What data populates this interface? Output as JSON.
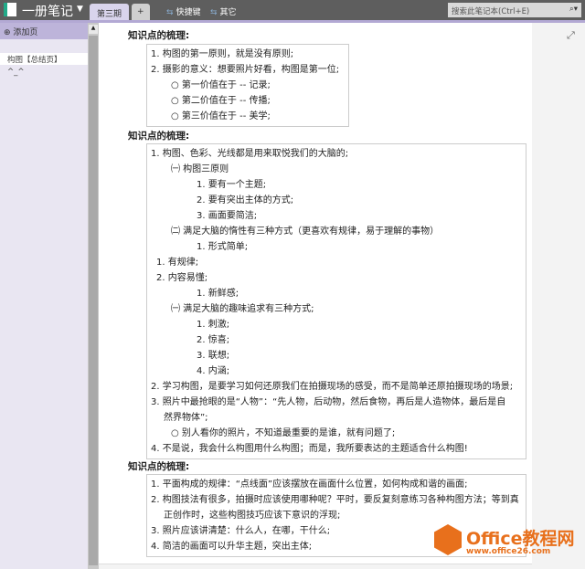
{
  "header": {
    "notebook_title": "一册笔记",
    "tabs": [
      {
        "label": "第三期"
      },
      {
        "label": "+"
      }
    ],
    "links": [
      {
        "label": "快捷键"
      },
      {
        "label": "其它"
      }
    ],
    "search_placeholder": "搜索此笔记本(Ctrl+E)"
  },
  "sidebar": {
    "add_page": "添加页",
    "pages": [
      {
        "label": "构图【总结页】"
      },
      {
        "label": "^_^"
      }
    ]
  },
  "sections": [
    {
      "heading": "知识点的梳理:",
      "lines": [
        {
          "indent": 0,
          "text": "1. 构图的第一原则，就是没有原则;"
        },
        {
          "indent": 0,
          "text": "2. 摄影的意义：想要照片好看，构图是第一位;"
        },
        {
          "indent": 1,
          "text": "○ 第一价值在于 -- 记录;"
        },
        {
          "indent": 1,
          "text": "○ 第二价值在于 -- 传播;"
        },
        {
          "indent": 1,
          "text": "○ 第三价值在于 -- 美学;"
        }
      ]
    },
    {
      "heading": "知识点的梳理:",
      "lines": [
        {
          "indent": 0,
          "text": "1. 构图、色彩、光线都是用来取悦我们的大脑的;"
        },
        {
          "indent": 1,
          "text": "㈠ 构图三原则"
        },
        {
          "indent": 2,
          "text": "1. 要有一个主题;"
        },
        {
          "indent": 2,
          "text": "2. 要有突出主体的方式;"
        },
        {
          "indent": 2,
          "text": "3. 画面要简洁;"
        },
        {
          "indent": 1,
          "text": "㈡ 满足大脑的惰性有三种方式（更喜欢有规律，易于理解的事物）"
        },
        {
          "indent": 2,
          "text": "1. 形式简单;"
        },
        {
          "indent": 3,
          "text": "1. 有规律;"
        },
        {
          "indent": 3,
          "text": "2. 内容易懂;"
        },
        {
          "indent": 2,
          "text": "1. 新鲜感;"
        },
        {
          "indent": 1,
          "text": "㈠ 满足大脑的趣味追求有三种方式;"
        },
        {
          "indent": 2,
          "text": "1. 刺激;"
        },
        {
          "indent": 2,
          "text": "2. 惊喜;"
        },
        {
          "indent": 2,
          "text": "3. 联想;"
        },
        {
          "indent": 2,
          "text": "4. 内涵;"
        },
        {
          "indent": 0,
          "text": "2. 学习构图，是要学习如何还原我们在拍摄现场的感受，而不是简单还原拍摄现场的场景;"
        },
        {
          "indent": 0,
          "text": "3. 照片中最抢眼的是“人物”：“先人物，后动物，然后食物，再后是人造物体，最后是自"
        },
        {
          "indent": 4,
          "text": "然界物体”;"
        },
        {
          "indent": 1,
          "text": "○ 别人看你的照片，不知道最重要的是谁，就有问题了;"
        },
        {
          "indent": 0,
          "text": "4. 不是说，我会什么构图用什么构图；而是，我所要表达的主题适合什么构图!"
        }
      ]
    },
    {
      "heading": "知识点的梳理:",
      "lines": [
        {
          "indent": 0,
          "text": "1. 平面构成的规律：“点线面”应该摆放在画面什么位置，如何构成和谐的画面;"
        },
        {
          "indent": 0,
          "text": "2. 构图技法有很多，拍摄时应该使用哪种呢？平时，要反复刻意练习各种构图方法；等到真"
        },
        {
          "indent": 4,
          "text": "正创作时，这些构图技巧应该下意识的浮现;"
        },
        {
          "indent": 0,
          "text": "3. 照片应该讲清楚：什么人，在哪，干什么;"
        },
        {
          "indent": 0,
          "text": "4. 简洁的画面可以升华主题，突出主体;"
        }
      ]
    }
  ],
  "watermark": {
    "brand": "Office教程网",
    "url": "www.office26.com"
  }
}
